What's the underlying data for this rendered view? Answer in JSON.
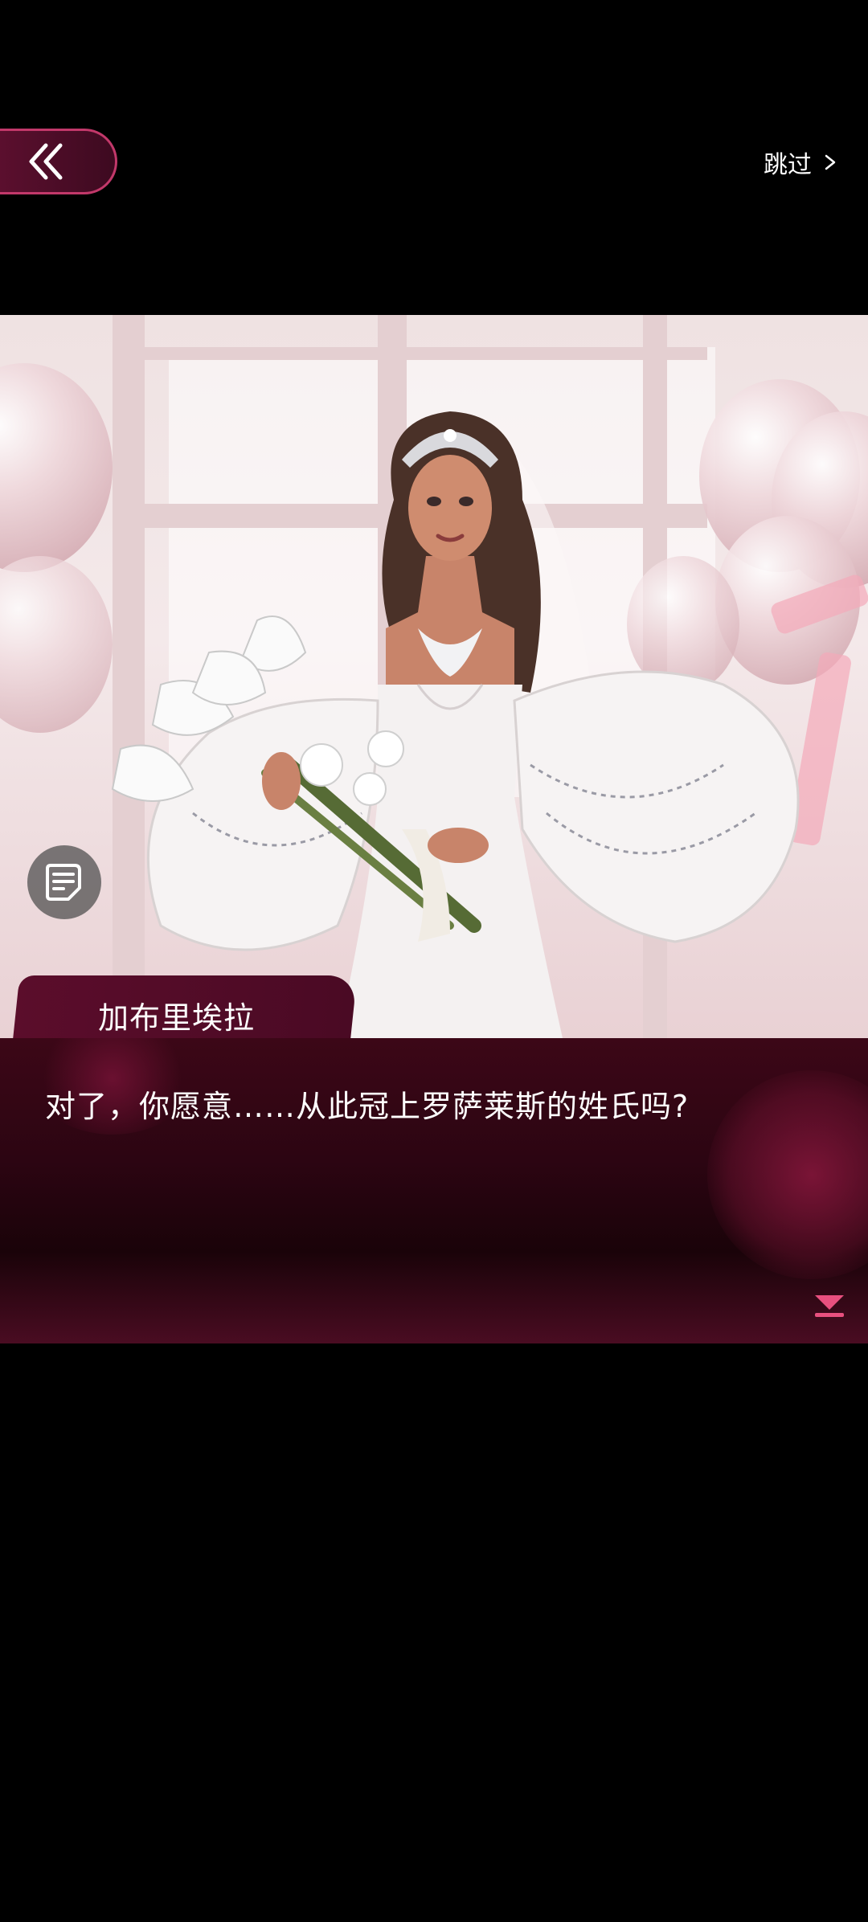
{
  "header": {
    "skip_label": "跳过"
  },
  "dialogue": {
    "speaker": "加布里埃拉",
    "text": "对了，你愿意……从此冠上罗萨莱斯的姓氏吗?"
  },
  "icons": {
    "back": "double-chevron-left-icon",
    "skip": "chevron-right-icon",
    "history": "log-document-icon",
    "next": "arrow-down-next-icon"
  },
  "colors": {
    "accent": "#c2386a",
    "dialog_bg": "#2c0512",
    "next_icon": "#e8507f"
  }
}
